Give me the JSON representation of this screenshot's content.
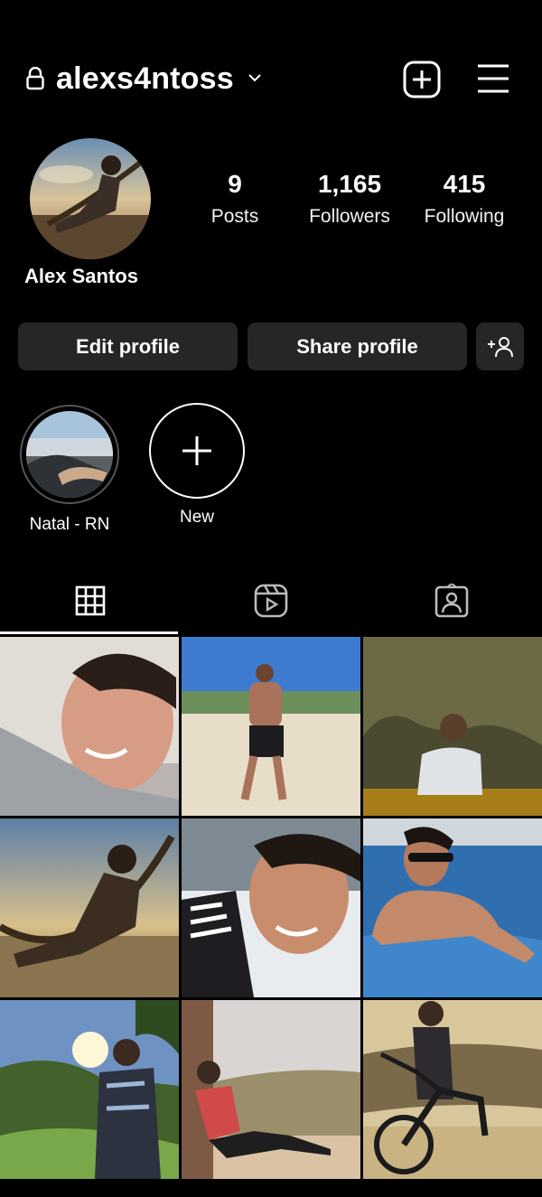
{
  "header": {
    "username": "alexs4ntoss",
    "icons": [
      "lock-icon",
      "chevron-down-icon",
      "add-square-icon",
      "menu-icon"
    ]
  },
  "profile": {
    "full_name": "Alex Santos",
    "stats": [
      {
        "value": "9",
        "label": "Posts"
      },
      {
        "value": "1,165",
        "label": "Followers"
      },
      {
        "value": "415",
        "label": "Following"
      }
    ]
  },
  "buttons": {
    "edit": "Edit profile",
    "share": "Share profile"
  },
  "highlights": [
    {
      "label": "Natal - RN"
    },
    {
      "label": "New"
    }
  ],
  "tabs": [
    {
      "name": "grid",
      "icon": "grid-icon",
      "active": true
    },
    {
      "name": "reels",
      "icon": "reels-icon",
      "active": false
    },
    {
      "name": "tagged",
      "icon": "tagged-icon",
      "active": false
    }
  ],
  "colors": {
    "background": "#000000",
    "button": "#262626",
    "text": "#ffffff"
  }
}
